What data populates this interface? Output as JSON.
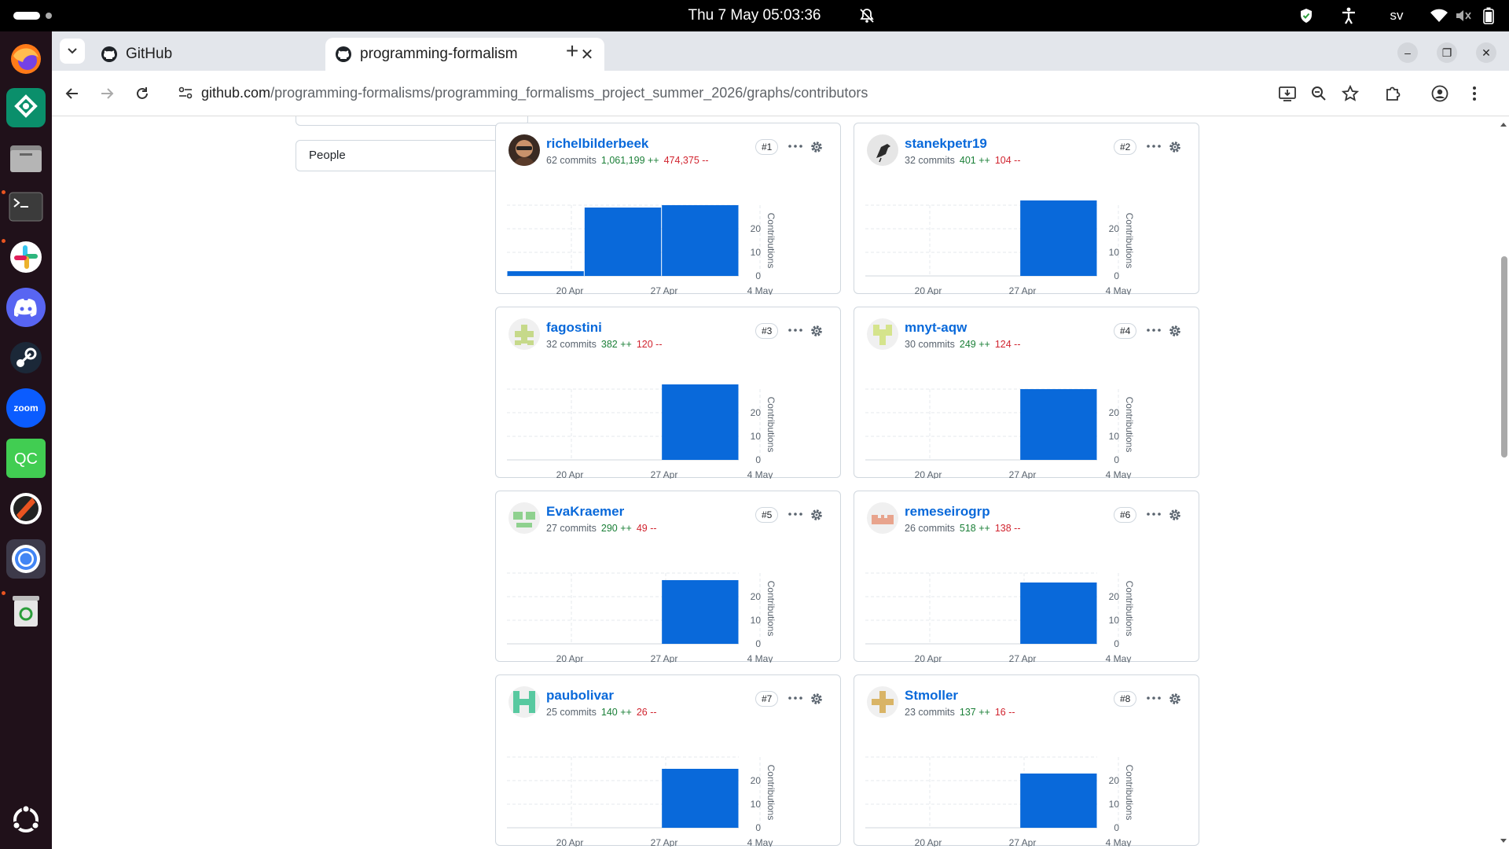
{
  "system": {
    "clock": "Thu 7 May  05:03:36",
    "language": "sv"
  },
  "browser": {
    "tabs": [
      {
        "title": "GitHub",
        "active": false
      },
      {
        "title": "programming-formalism",
        "active": true
      }
    ],
    "url_host": "github.com",
    "url_path": "/programming-formalisms/programming_formalisms_project_summer_2026/graphs/contributors"
  },
  "sidebar": {
    "people_label": "People"
  },
  "chart_axis": {
    "x_ticks": [
      "20 Apr",
      "27 Apr",
      "4 May"
    ],
    "y_ticks": [
      "20",
      "10",
      "0"
    ],
    "ylabel": "Contributions",
    "ylim": [
      0,
      30
    ]
  },
  "colors": {
    "bar": "#0969da",
    "link": "#0969da",
    "additions": "#1a7f37",
    "deletions": "#d1242f"
  },
  "contributors": [
    {
      "name": "richelbilderbeek",
      "rank": "#1",
      "commits": "62 commits",
      "additions": "1,061,199 ++",
      "deletions": "474,375 --",
      "avatar": "photo-avatar",
      "chart_data": {
        "type": "bar",
        "categories": [
          "w1",
          "w2",
          "w3"
        ],
        "values": [
          2,
          29,
          30
        ],
        "ylabel": "Contributions"
      }
    },
    {
      "name": "stanekpetr19",
      "rank": "#2",
      "commits": "32 commits",
      "additions": "401 ++",
      "deletions": "104 --",
      "avatar": "bird-avatar",
      "chart_data": {
        "type": "bar",
        "categories": [
          "w1",
          "w2",
          "w3"
        ],
        "values": [
          0,
          0,
          32
        ],
        "ylabel": "Contributions"
      }
    },
    {
      "name": "fagostini",
      "rank": "#3",
      "commits": "32 commits",
      "additions": "382 ++",
      "deletions": "120 --",
      "avatar": "identicon-green",
      "chart_data": {
        "type": "bar",
        "categories": [
          "w1",
          "w2",
          "w3"
        ],
        "values": [
          0,
          0,
          32
        ],
        "ylabel": "Contributions"
      }
    },
    {
      "name": "mnyt-aqw",
      "rank": "#4",
      "commits": "30 commits",
      "additions": "249 ++",
      "deletions": "124 --",
      "avatar": "identicon-lime",
      "chart_data": {
        "type": "bar",
        "categories": [
          "w1",
          "w2",
          "w3"
        ],
        "values": [
          0,
          0,
          30
        ],
        "ylabel": "Contributions"
      }
    },
    {
      "name": "EvaKraemer",
      "rank": "#5",
      "commits": "27 commits",
      "additions": "290 ++",
      "deletions": "49 --",
      "avatar": "identicon-green2",
      "chart_data": {
        "type": "bar",
        "categories": [
          "w1",
          "w2",
          "w3"
        ],
        "values": [
          0,
          0,
          27
        ],
        "ylabel": "Contributions"
      }
    },
    {
      "name": "remeseirogrp",
      "rank": "#6",
      "commits": "26 commits",
      "additions": "518 ++",
      "deletions": "138 --",
      "avatar": "identicon-salmon",
      "chart_data": {
        "type": "bar",
        "categories": [
          "w1",
          "w2",
          "w3"
        ],
        "values": [
          0,
          0,
          26
        ],
        "ylabel": "Contributions"
      }
    },
    {
      "name": "paubolivar",
      "rank": "#7",
      "commits": "25 commits",
      "additions": "140 ++",
      "deletions": "26 --",
      "avatar": "identicon-teal",
      "chart_data": {
        "type": "bar",
        "categories": [
          "w1",
          "w2",
          "w3"
        ],
        "values": [
          0,
          0,
          25
        ],
        "ylabel": "Contributions"
      }
    },
    {
      "name": "Stmoller",
      "rank": "#8",
      "commits": "23 commits",
      "additions": "137 ++",
      "deletions": "16 --",
      "avatar": "identicon-tan",
      "chart_data": {
        "type": "bar",
        "categories": [
          "w1",
          "w2",
          "w3"
        ],
        "values": [
          0,
          0,
          23
        ],
        "ylabel": "Contributions"
      }
    }
  ]
}
